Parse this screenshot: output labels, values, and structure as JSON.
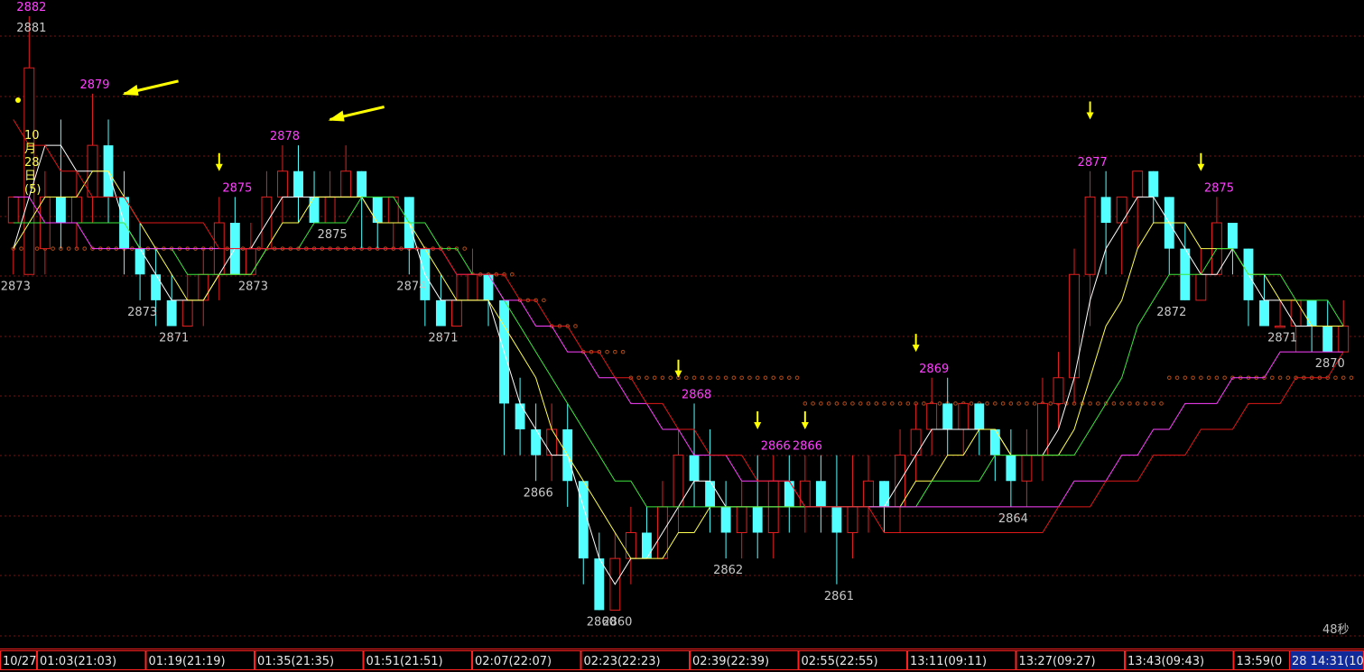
{
  "chart_data": {
    "type": "candlestick",
    "ylim": [
      2859,
      2883
    ],
    "grid": true,
    "colors": {
      "background": "#000000",
      "up": "#e02020",
      "down": "#54ffff",
      "ma_white": "#ffffff",
      "ma_yellow": "#ffff50",
      "ma_green": "#3ce63c",
      "ma_magenta": "#ff40ff",
      "ma_red": "#e01818",
      "dots": "#b04a18",
      "grid": "#7a1010",
      "annotation_high": "#ff40ff",
      "annotation_low": "#c8c8c8",
      "arrow": "#ffff00",
      "timebar": "#ff2020"
    },
    "candles": [
      [
        2875,
        2876,
        2874,
        2873
      ],
      [
        2873,
        2881,
        2883,
        2873
      ],
      [
        2874,
        2876,
        2877,
        2873
      ],
      [
        2876,
        2875,
        2879,
        2874
      ],
      [
        2875,
        2876,
        2877,
        2874
      ],
      [
        2876,
        2878,
        2880,
        2875
      ],
      [
        2878,
        2876,
        2879,
        2875
      ],
      [
        2876,
        2874,
        2877,
        2873
      ],
      [
        2874,
        2873,
        2875,
        2872
      ],
      [
        2873,
        2872,
        2874,
        2871
      ],
      [
        2872,
        2871,
        2873,
        2871
      ],
      [
        2871,
        2872,
        2873,
        2871
      ],
      [
        2872,
        2873,
        2874,
        2871
      ],
      [
        2873,
        2875,
        2876,
        2872
      ],
      [
        2875,
        2873,
        2876,
        2873
      ],
      [
        2873,
        2874,
        2875,
        2873
      ],
      [
        2874,
        2876,
        2877,
        2874
      ],
      [
        2876,
        2877,
        2878,
        2875
      ],
      [
        2877,
        2876,
        2878,
        2875
      ],
      [
        2876,
        2875,
        2877,
        2875
      ],
      [
        2875,
        2876,
        2877,
        2875
      ],
      [
        2876,
        2877,
        2878,
        2876
      ],
      [
        2877,
        2876,
        2877,
        2874
      ],
      [
        2876,
        2875,
        2876,
        2874
      ],
      [
        2875,
        2876,
        2876,
        2874
      ],
      [
        2876,
        2874,
        2876,
        2873
      ],
      [
        2874,
        2872,
        2874,
        2871
      ],
      [
        2872,
        2871,
        2873,
        2871
      ],
      [
        2871,
        2872,
        2873,
        2871
      ],
      [
        2872,
        2873,
        2874,
        2872
      ],
      [
        2873,
        2872,
        2873,
        2871
      ],
      [
        2872,
        2868,
        2872,
        2866
      ],
      [
        2868,
        2867,
        2869,
        2866
      ],
      [
        2867,
        2866,
        2868,
        2865
      ],
      [
        2866,
        2867,
        2868,
        2865
      ],
      [
        2867,
        2865,
        2868,
        2864
      ],
      [
        2865,
        2862,
        2865,
        2861
      ],
      [
        2862,
        2860,
        2863,
        2860
      ],
      [
        2860,
        2862,
        2863,
        2860
      ],
      [
        2862,
        2863,
        2864,
        2861
      ],
      [
        2863,
        2862,
        2864,
        2862
      ],
      [
        2862,
        2864,
        2865,
        2862
      ],
      [
        2864,
        2866,
        2867,
        2863
      ],
      [
        2866,
        2865,
        2868,
        2864
      ],
      [
        2865,
        2864,
        2867,
        2863
      ],
      [
        2864,
        2863,
        2865,
        2862
      ],
      [
        2863,
        2864,
        2865,
        2862
      ],
      [
        2864,
        2863,
        2866,
        2862
      ],
      [
        2863,
        2865,
        2866,
        2862
      ],
      [
        2865,
        2864,
        2866,
        2863
      ],
      [
        2864,
        2865,
        2866,
        2863
      ],
      [
        2865,
        2864,
        2866,
        2863
      ],
      [
        2864,
        2863,
        2866,
        2861
      ],
      [
        2863,
        2864,
        2866,
        2862
      ],
      [
        2864,
        2865,
        2866,
        2863
      ],
      [
        2865,
        2864,
        2865,
        2863
      ],
      [
        2864,
        2866,
        2867,
        2863
      ],
      [
        2866,
        2867,
        2868,
        2865
      ],
      [
        2867,
        2868,
        2869,
        2866
      ],
      [
        2868,
        2867,
        2869,
        2866
      ],
      [
        2867,
        2868,
        2868,
        2866
      ],
      [
        2868,
        2867,
        2868,
        2866
      ],
      [
        2867,
        2866,
        2867,
        2865
      ],
      [
        2866,
        2865,
        2867,
        2864
      ],
      [
        2865,
        2866,
        2867,
        2864
      ],
      [
        2866,
        2868,
        2869,
        2865
      ],
      [
        2868,
        2869,
        2870,
        2867
      ],
      [
        2869,
        2873,
        2874,
        2868
      ],
      [
        2873,
        2876,
        2877,
        2871
      ],
      [
        2876,
        2875,
        2877,
        2873
      ],
      [
        2875,
        2876,
        2876,
        2873
      ],
      [
        2876,
        2877,
        2877,
        2874
      ],
      [
        2877,
        2876,
        2877,
        2875
      ],
      [
        2876,
        2874,
        2876,
        2873
      ],
      [
        2874,
        2872,
        2875,
        2872
      ],
      [
        2872,
        2873,
        2874,
        2872
      ],
      [
        2873,
        2875,
        2876,
        2873
      ],
      [
        2875,
        2874,
        2875,
        2873
      ],
      [
        2874,
        2872,
        2874,
        2871
      ],
      [
        2872,
        2871,
        2873,
        2871
      ],
      [
        2871,
        2871,
        2872,
        2871
      ],
      [
        2871,
        2872,
        2872,
        2870
      ],
      [
        2872,
        2871,
        2872,
        2870
      ],
      [
        2871,
        2870,
        2872,
        2870
      ],
      [
        2870,
        2871,
        2872,
        2870
      ]
    ],
    "series": [
      {
        "name": "",
        "color": "#ffffff",
        "values": [
          2874,
          2876,
          2878,
          2878,
          2877,
          2877,
          2877,
          2875,
          2874,
          2873,
          2872,
          2872,
          2872,
          2873,
          2874,
          2874,
          2875,
          2876,
          2876,
          2876,
          2876,
          2876,
          2876,
          2875,
          2875,
          2875,
          2873,
          2872,
          2872,
          2872,
          2872,
          2870,
          2868,
          2867,
          2866,
          2866,
          2864,
          2862,
          2861,
          2862,
          2862,
          2863,
          2864,
          2865,
          2865,
          2864,
          2864,
          2864,
          2864,
          2864,
          2864,
          2864,
          2864,
          2864,
          2864,
          2864,
          2865,
          2866,
          2867,
          2867,
          2867,
          2867,
          2867,
          2866,
          2866,
          2866,
          2867,
          2869,
          2872,
          2874,
          2875,
          2876,
          2876,
          2875,
          2874,
          2873,
          2873,
          2874,
          2873,
          2872,
          2872,
          2871,
          2871,
          2871,
          2871
        ]
      },
      {
        "name": "",
        "color": "#ffff50",
        "values": [
          2874,
          2875,
          2876,
          2876,
          2876,
          2877,
          2877,
          2876,
          2875,
          2874,
          2873,
          2872,
          2872,
          2873,
          2873,
          2873,
          2874,
          2875,
          2875,
          2876,
          2876,
          2876,
          2876,
          2875,
          2875,
          2875,
          2874,
          2873,
          2872,
          2872,
          2872,
          2871,
          2870,
          2869,
          2867,
          2866,
          2865,
          2864,
          2863,
          2862,
          2862,
          2862,
          2863,
          2863,
          2864,
          2864,
          2864,
          2864,
          2864,
          2864,
          2864,
          2864,
          2864,
          2864,
          2864,
          2864,
          2864,
          2865,
          2865,
          2866,
          2866,
          2867,
          2867,
          2866,
          2866,
          2866,
          2866,
          2867,
          2869,
          2871,
          2872,
          2874,
          2875,
          2875,
          2875,
          2874,
          2874,
          2874,
          2873,
          2873,
          2872,
          2872,
          2871,
          2871,
          2871
        ]
      },
      {
        "name": "",
        "color": "#3ce63c",
        "values": [
          2875,
          2875,
          2875,
          2875,
          2875,
          2875,
          2875,
          2875,
          2874,
          2874,
          2874,
          2873,
          2873,
          2873,
          2873,
          2873,
          2874,
          2874,
          2874,
          2875,
          2875,
          2875,
          2876,
          2876,
          2876,
          2875,
          2875,
          2874,
          2874,
          2873,
          2873,
          2872,
          2871,
          2870,
          2869,
          2868,
          2867,
          2866,
          2865,
          2865,
          2864,
          2864,
          2864,
          2864,
          2864,
          2864,
          2864,
          2864,
          2864,
          2864,
          2864,
          2864,
          2864,
          2864,
          2864,
          2864,
          2864,
          2864,
          2865,
          2865,
          2865,
          2865,
          2866,
          2866,
          2866,
          2866,
          2866,
          2866,
          2867,
          2868,
          2869,
          2871,
          2872,
          2873,
          2873,
          2873,
          2874,
          2874,
          2873,
          2873,
          2873,
          2872,
          2872,
          2872,
          2871
        ]
      },
      {
        "name": "",
        "color": "#ff40ff",
        "values": [
          2876,
          2876,
          2875,
          2875,
          2875,
          2874,
          2874,
          2874,
          2874,
          2874,
          2874,
          2874,
          2874,
          2874,
          2874,
          2874,
          2874,
          2874,
          2874,
          2874,
          2874,
          2874,
          2874,
          2874,
          2874,
          2874,
          2874,
          2874,
          2873,
          2873,
          2873,
          2872,
          2872,
          2871,
          2871,
          2870,
          2870,
          2869,
          2869,
          2868,
          2868,
          2867,
          2867,
          2866,
          2866,
          2866,
          2865,
          2865,
          2865,
          2865,
          2864,
          2864,
          2864,
          2864,
          2864,
          2864,
          2864,
          2864,
          2864,
          2864,
          2864,
          2864,
          2864,
          2864,
          2864,
          2864,
          2864,
          2865,
          2865,
          2865,
          2866,
          2866,
          2867,
          2867,
          2868,
          2868,
          2868,
          2869,
          2869,
          2869,
          2870,
          2870,
          2870,
          2870,
          2870
        ]
      },
      {
        "name": "",
        "color": "#e01818",
        "values": [
          2879,
          2878,
          2878,
          2877,
          2877,
          2876,
          2876,
          2876,
          2875,
          2875,
          2875,
          2875,
          2875,
          2874,
          2874,
          2874,
          2874,
          2874,
          2874,
          2874,
          2874,
          2874,
          2874,
          2874,
          2874,
          2874,
          2874,
          2874,
          2873,
          2873,
          2873,
          2873,
          2872,
          2872,
          2871,
          2871,
          2870,
          2870,
          2869,
          2869,
          2868,
          2868,
          2867,
          2867,
          2866,
          2866,
          2866,
          2865,
          2865,
          2865,
          2864,
          2864,
          2864,
          2864,
          2864,
          2863,
          2863,
          2863,
          2863,
          2863,
          2863,
          2863,
          2863,
          2863,
          2863,
          2863,
          2864,
          2864,
          2864,
          2865,
          2865,
          2865,
          2866,
          2866,
          2866,
          2867,
          2867,
          2867,
          2868,
          2868,
          2868,
          2869,
          2869,
          2869,
          2870
        ]
      },
      {
        "name": "",
        "color": "#b04a18",
        "style": "dots",
        "values": [
          2874,
          2874,
          2874,
          2874,
          2874,
          2874,
          2874,
          2874,
          2874,
          2874,
          2874,
          2874,
          2874,
          2874,
          2874,
          2874,
          2874,
          2874,
          2874,
          2874,
          2874,
          2874,
          2874,
          2874,
          2874,
          2874,
          2874,
          2874,
          2874,
          2873,
          2873,
          2873,
          2872,
          2872,
          2871,
          2871,
          2870,
          2870,
          2870,
          2869,
          2869,
          2869,
          2869,
          2869,
          2869,
          2869,
          2869,
          2869,
          2869,
          2869,
          2868,
          2868,
          2868,
          2868,
          2868,
          2868,
          2868,
          2868,
          2868,
          2868,
          2868,
          2868,
          2868,
          2868,
          2868,
          2868,
          2868,
          2868,
          2868,
          2868,
          2868,
          2868,
          2868,
          2869,
          2869,
          2869,
          2869,
          2869,
          2869,
          2869,
          2869,
          2869,
          2869,
          2869,
          2869
        ]
      }
    ],
    "annotations": [
      {
        "text": "2882",
        "kind": "high",
        "index": 1,
        "value": 2883
      },
      {
        "text": "2881",
        "kind": "low",
        "index": 1,
        "value": 2883
      },
      {
        "text": "2879",
        "kind": "high",
        "index": 5,
        "value": 2880
      },
      {
        "text": "2873",
        "kind": "low",
        "index": 0,
        "value": 2873
      },
      {
        "text": "2873",
        "kind": "low",
        "index": 8,
        "value": 2872
      },
      {
        "text": "2871",
        "kind": "low",
        "index": 10,
        "value": 2871
      },
      {
        "text": "2875",
        "kind": "high",
        "index": 14,
        "value": 2876
      },
      {
        "text": "2873",
        "kind": "low",
        "index": 15,
        "value": 2873
      },
      {
        "text": "2878",
        "kind": "high",
        "index": 17,
        "value": 2878
      },
      {
        "text": "2875",
        "kind": "low",
        "index": 20,
        "value": 2875
      },
      {
        "text": "2874",
        "kind": "low",
        "index": 25,
        "value": 2873
      },
      {
        "text": "2871",
        "kind": "low",
        "index": 27,
        "value": 2871
      },
      {
        "text": "2866",
        "kind": "low",
        "index": 33,
        "value": 2865
      },
      {
        "text": "2860",
        "kind": "low",
        "index": 37,
        "value": 2860
      },
      {
        "text": "2860",
        "kind": "low",
        "index": 38,
        "value": 2860
      },
      {
        "text": "2868",
        "kind": "high",
        "index": 43,
        "value": 2868
      },
      {
        "text": "2862",
        "kind": "low",
        "index": 45,
        "value": 2862
      },
      {
        "text": "2866",
        "kind": "high",
        "index": 48,
        "value": 2866
      },
      {
        "text": "2866",
        "kind": "high",
        "index": 50,
        "value": 2866
      },
      {
        "text": "2861",
        "kind": "low",
        "index": 52,
        "value": 2861
      },
      {
        "text": "2869",
        "kind": "high",
        "index": 58,
        "value": 2869
      },
      {
        "text": "2864",
        "kind": "low",
        "index": 63,
        "value": 2864
      },
      {
        "text": "2877",
        "kind": "high",
        "index": 68,
        "value": 2877
      },
      {
        "text": "2872",
        "kind": "low",
        "index": 73,
        "value": 2872
      },
      {
        "text": "2875",
        "kind": "high",
        "index": 76,
        "value": 2876
      },
      {
        "text": "2871",
        "kind": "low",
        "index": 80,
        "value": 2871
      },
      {
        "text": "2870",
        "kind": "low",
        "index": 83,
        "value": 2870
      }
    ],
    "arrows": [
      {
        "direction": "left",
        "index": 7,
        "value": 2880
      },
      {
        "direction": "down",
        "index": 13,
        "value": 2877
      },
      {
        "direction": "left",
        "index": 20,
        "value": 2879
      },
      {
        "direction": "down",
        "index": 42,
        "value": 2869
      },
      {
        "direction": "down",
        "index": 47,
        "value": 2867
      },
      {
        "direction": "down",
        "index": 50,
        "value": 2867
      },
      {
        "direction": "down",
        "index": 57,
        "value": 2870
      },
      {
        "direction": "down",
        "index": 68,
        "value": 2879
      },
      {
        "direction": "down",
        "index": 75,
        "value": 2877
      }
    ],
    "date_label": [
      "10",
      "月",
      "28",
      "日",
      "(5)"
    ],
    "countdown": "48秒",
    "time_labels": [
      "10/27",
      "01:03(21:03)",
      "01:19(21:19)",
      "01:35(21:35)",
      "01:51(21:51)",
      "02:07(22:07)",
      "02:23(22:23)",
      "02:39(22:39)",
      "02:55(22:55)",
      "13:11(09:11)",
      "13:27(09:27)",
      "13:43(09:43)",
      "13:59(0",
      "28  14:31(10"
    ]
  }
}
